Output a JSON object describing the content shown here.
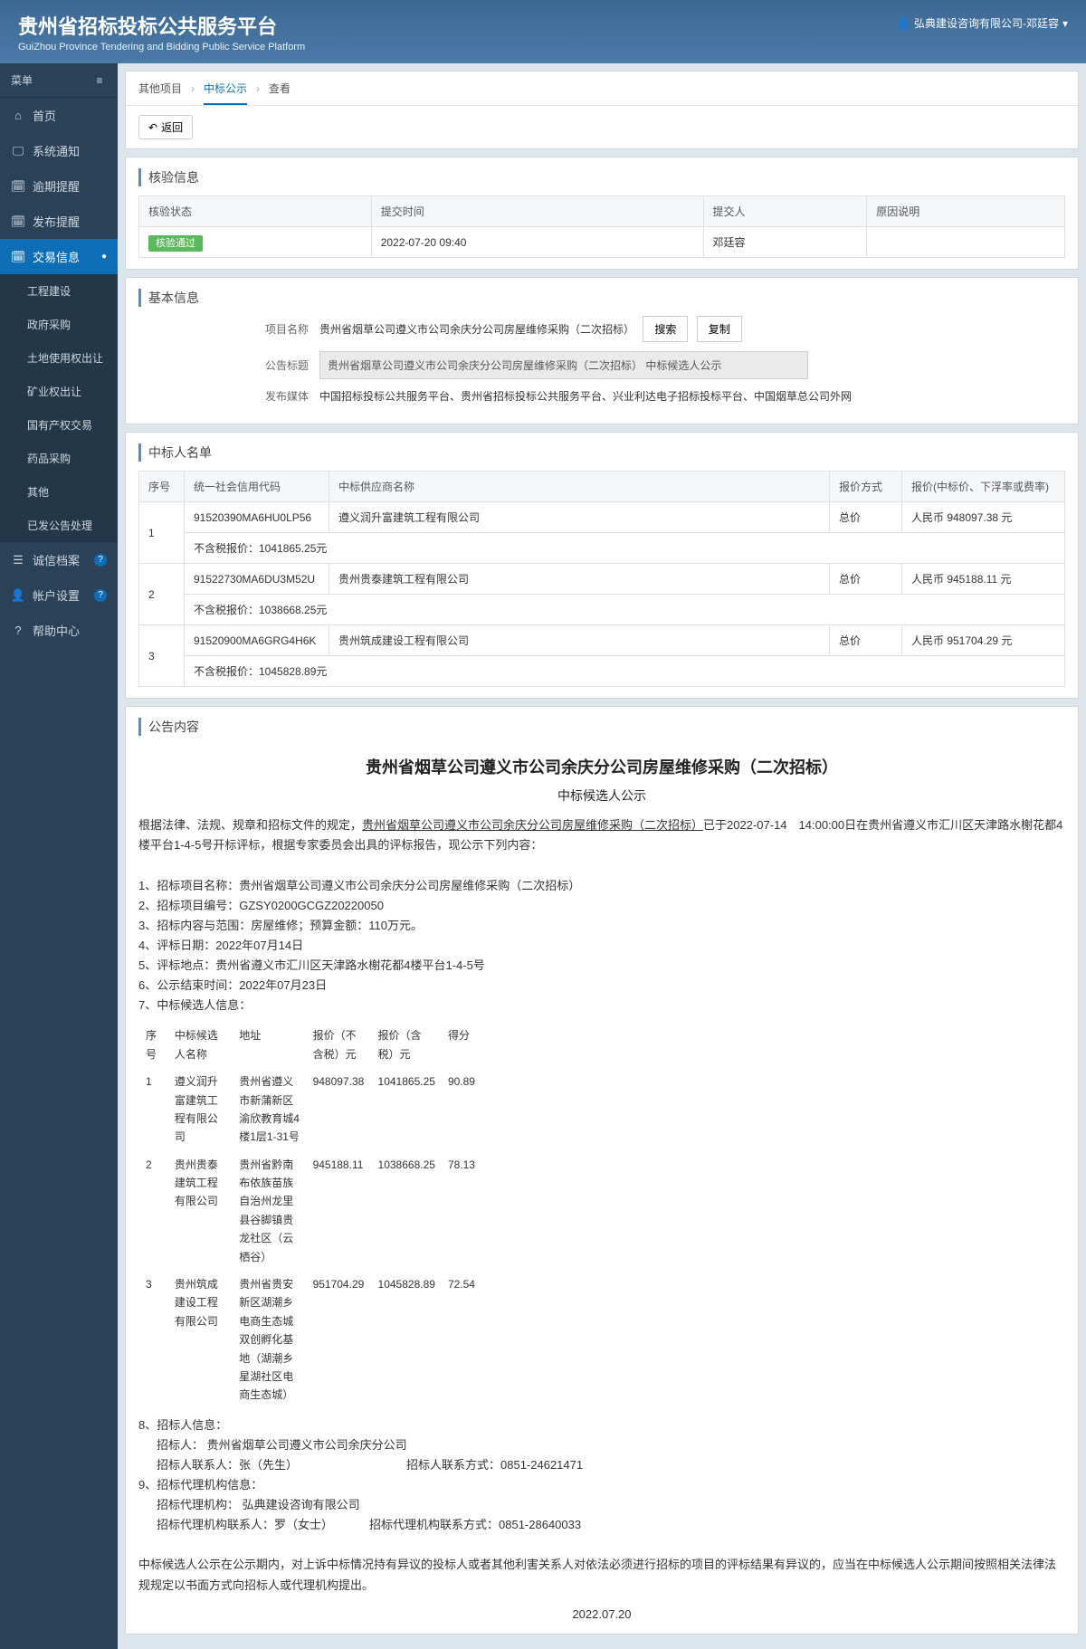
{
  "header": {
    "title_cn": "贵州省招标投标公共服务平台",
    "title_en": "GuiZhou Province Tendering and Bidding Public Service Platform",
    "user": "弘典建设咨询有限公司-邓廷容"
  },
  "sidebar": {
    "menu_label": "菜单",
    "items": [
      {
        "label": "首页",
        "icon": "home"
      },
      {
        "label": "系统通知",
        "icon": "monitor"
      },
      {
        "label": "逾期提醒",
        "icon": "calendar"
      },
      {
        "label": "发布提醒",
        "icon": "calendar"
      },
      {
        "label": "交易信息",
        "icon": "calendar",
        "active": true
      }
    ],
    "sub_items": [
      {
        "label": "工程建设"
      },
      {
        "label": "政府采购"
      },
      {
        "label": "土地使用权出让"
      },
      {
        "label": "矿业权出让"
      },
      {
        "label": "国有产权交易"
      },
      {
        "label": "药品采购"
      },
      {
        "label": "其他"
      },
      {
        "label": "已发公告处理"
      }
    ],
    "items2": [
      {
        "label": "诚信档案",
        "icon": "list",
        "badge": "?"
      },
      {
        "label": "帐户设置",
        "icon": "user",
        "badge": "?"
      },
      {
        "label": "帮助中心",
        "icon": "help"
      }
    ]
  },
  "breadcrumb": {
    "a": "其他项目",
    "b": "中标公示",
    "c": "查看"
  },
  "back_label": "返回",
  "verify": {
    "title": "核验信息",
    "cols": [
      "核验状态",
      "提交时间",
      "提交人",
      "原因说明"
    ],
    "row": {
      "status": "核验通过",
      "time": "2022-07-20 09:40",
      "person": "邓廷容",
      "reason": ""
    }
  },
  "basic": {
    "title": "基本信息",
    "project_name_label": "项目名称",
    "project_name": "贵州省烟草公司遵义市公司余庆分公司房屋维修采购（二次招标）",
    "search_btn": "搜索",
    "copy_btn": "复制",
    "notice_title_label": "公告标题",
    "notice_title": "贵州省烟草公司遵义市公司余庆分公司房屋维修采购（二次招标） 中标候选人公示",
    "media_label": "发布媒体",
    "media": "中国招标投标公共服务平台、贵州省招标投标公共服务平台、兴业利达电子招标投标平台、中国烟草总公司外网"
  },
  "winners": {
    "title": "中标人名单",
    "cols": [
      "序号",
      "统一社会信用代码",
      "中标供应商名称",
      "报价方式",
      "报价(中标价、下浮率或费率)"
    ],
    "rows": [
      {
        "no": "1",
        "code": "91520390MA6HU0LP56",
        "name": "遵义润升富建筑工程有限公司",
        "method": "总价",
        "price": "人民币 948097.38 元",
        "tax_note": "不含税报价：1041865.25元"
      },
      {
        "no": "2",
        "code": "91522730MA6DU3M52U",
        "name": "贵州贵泰建筑工程有限公司",
        "method": "总价",
        "price": "人民币 945188.11 元",
        "tax_note": "不含税报价：1038668.25元"
      },
      {
        "no": "3",
        "code": "91520900MA6GRG4H6K",
        "name": "贵州筑成建设工程有限公司",
        "method": "总价",
        "price": "人民币 951704.29 元",
        "tax_note": "不含税报价：1045828.89元"
      }
    ]
  },
  "notice": {
    "title_section": "公告内容",
    "title": "贵州省烟草公司遵义市公司余庆分公司房屋维修采购（二次招标）",
    "subtitle": "中标候选人公示",
    "intro_prefix": "根据法律、法规、规章和招标文件的规定，",
    "intro_underline": "贵州省烟草公司遵义市公司余庆分公司房屋维修采购（二次招标）",
    "intro_suffix": "已于2022-07-14　14:00:00日在贵州省遵义市汇川区天津路水榭花都4楼平台1-4-5号开标评标，根据专家委员会出具的评标报告，现公示下列内容：",
    "line1": "1、招标项目名称：贵州省烟草公司遵义市公司余庆分公司房屋维修采购（二次招标）",
    "line2": "2、招标项目编号：GZSY0200GCGZ20220050",
    "line3": "3、招标内容与范围：房屋维修；预算金额：110万元。",
    "line4": "4、评标日期：2022年07月14日",
    "line5": "5、评标地点：贵州省遵义市汇川区天津路水榭花都4楼平台1-4-5号",
    "line6": "6、公示结束时间：2022年07月23日",
    "line7": "7、中标候选人信息：",
    "cand_cols": [
      "序号",
      "中标候选人名称",
      "地址",
      "报价（不含税）元",
      "报价（含税）元",
      "得分"
    ],
    "cand_rows": [
      {
        "no": "1",
        "name": "遵义润升富建筑工程有限公司",
        "addr": "贵州省遵义市新蒲新区渝欣教育城4楼1层1-31号",
        "p1": "948097.38",
        "p2": "1041865.25",
        "score": "90.89"
      },
      {
        "no": "2",
        "name": "贵州贵泰建筑工程有限公司",
        "addr": "贵州省黔南布依族苗族自治州龙里县谷脚镇贵龙社区（云栖谷）",
        "p1": "945188.11",
        "p2": "1038668.25",
        "score": "78.13"
      },
      {
        "no": "3",
        "name": "贵州筑成建设工程有限公司",
        "addr": "贵州省贵安新区湖潮乡电商生态城双创孵化基地（湖潮乡星湖社区电商生态城）",
        "p1": "951704.29",
        "p2": "1045828.89",
        "score": "72.54"
      }
    ],
    "line8": "8、招标人信息：",
    "line8a": "招标人： 贵州省烟草公司遵义市公司余庆分公司",
    "line8b_l": "招标人联系人：张（先生）",
    "line8b_r": "招标人联系方式：0851-24621471",
    "line9": "9、招标代理机构信息：",
    "line9a": "招标代理机构： 弘典建设咨询有限公司",
    "line9b_l": "招标代理机构联系人：罗（女士）",
    "line9b_r": "招标代理机构联系方式：0851-28640033",
    "para": "中标候选人公示在公示期内，对上诉中标情况持有异议的投标人或者其他利害关系人对依法必须进行招标的项目的评标结果有异议的，应当在中标候选人公示期间按照相关法律法规规定以书面方式向招标人或代理机构提出。",
    "date": "2022.07.20"
  }
}
